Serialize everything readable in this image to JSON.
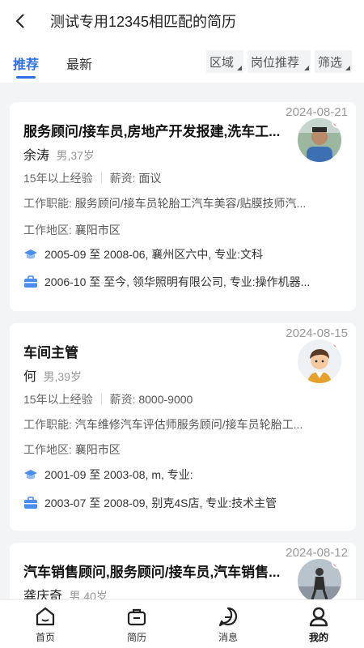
{
  "header": {
    "title": "测试专用12345相匹配的简历"
  },
  "tabs": [
    {
      "label": "推荐",
      "active": true
    },
    {
      "label": "最新",
      "active": false
    }
  ],
  "filters": [
    {
      "label": "区域"
    },
    {
      "label": "岗位推荐"
    },
    {
      "label": "筛选"
    }
  ],
  "labels": {
    "salary": "薪资:",
    "duty": "工作职能:",
    "region": "工作地区:"
  },
  "resumes": [
    {
      "date": "2024-08-21",
      "job": "服务顾问/接车员,房地产开发报建,洗车工...",
      "name": "余涛",
      "gender_age": "男,37岁",
      "experience": "15年以上经验",
      "salary": "面议",
      "duty": "服务顾问/接车员轮胎工汽车美容/贴膜技师汽...",
      "region": "襄阳市区",
      "education": "2005-09 至 2008-06, 襄州区六中, 专业:文科",
      "work": "2006-10 至 至今, 领华照明有限公司, 专业:操作机器...",
      "avatar_icon": "person-photo-icon"
    },
    {
      "date": "2024-08-15",
      "job": "车间主管",
      "name": "何",
      "gender_age": "男,39岁",
      "experience": "15年以上经验",
      "salary": "8000-9000",
      "duty": "汽车维修汽车评估师服务顾问/接车员轮胎工...",
      "region": "襄阳市区",
      "education": "2001-09 至 2003-08, m, 专业:",
      "work": "2003-07 至 2008-09, 别克4S店, 专业:技术主管",
      "avatar_icon": "cartoon-man-avatar-icon"
    },
    {
      "date": "2024-08-12",
      "job": "汽车销售顾问,服务顾问/接车员,汽车销售...",
      "name": "龚庆奇",
      "gender_age": "男,40岁",
      "avatar_icon": "person-photo-icon"
    }
  ],
  "bottom_nav": [
    {
      "label": "首页",
      "icon": "home-icon"
    },
    {
      "label": "简历",
      "icon": "resume-bag-icon"
    },
    {
      "label": "消息",
      "icon": "message-icon"
    },
    {
      "label": "我的",
      "icon": "profile-icon",
      "active": true
    }
  ],
  "colors": {
    "accent": "#2f6fe6",
    "badge": "#f05a6e",
    "background": "#f3f4f6"
  }
}
